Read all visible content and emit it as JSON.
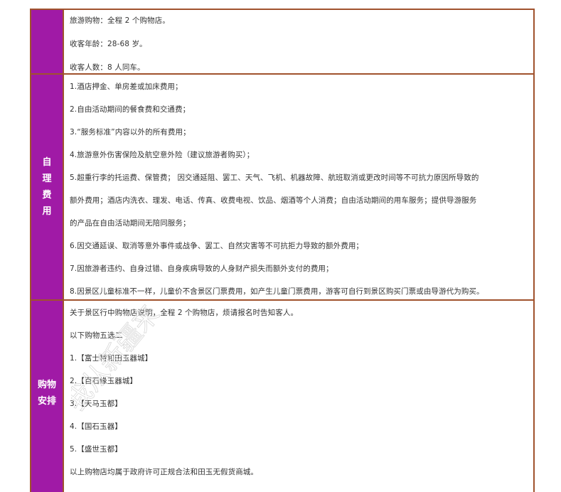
{
  "rows": [
    {
      "label": "",
      "lines": [
        "旅游购物：全程 2 个购物店。",
        "收客年龄：28-68 岁。",
        "收客人数：8 人同车。"
      ]
    },
    {
      "label_lines": [
        "自",
        "理",
        "费",
        "用"
      ],
      "lines": [
        "1.酒店押金、单房差或加床费用；",
        "2.自由活动期间的餐食费和交通费；",
        "3.“服务标准”内容以外的所有费用；",
        "4.旅游意外伤害保险及航空意外险（建议旅游者购买）；",
        "5.超重行李的托运费、保管费；  因交通延阻、罢工、天气、飞机、机器故障、航班取消或更改时间等不可抗力原因所导致的",
        "额外费用；酒店内洗衣、理发、电话、传真、收费电视、饮品、烟酒等个人消费；自由活动期间的用车服务；提供导游服务",
        "的产品在自由活动期间无陪同服务；",
        "6.因交通延误、取消等意外事件或战争、罢工、自然灾害等不可抗拒力导致的额外费用；",
        "7.因旅游者违约、自身过错、自身疾病导致的人身财产损失而额外支付的费用；",
        "8.因景区儿童标准不一样，儿童价不含景区门票费用，如产生儿童门票费用，游客可自行到景区购买门票或由导游代为购买。"
      ]
    },
    {
      "label_lines": [
        "购物",
        "安排"
      ],
      "lines": [
        "关于景区行中购物店说明，全程 2 个购物店，烦请报名时告知客人。",
        "以下购物五选二",
        "1.【富士特和田玉器城】",
        "2.【百石缘玉器城】",
        "3.【天马玉都】",
        "4.【国石玉器】",
        "5.【盛世玉都】",
        "以上购物店均属于政府许可正规合法和田玉无假货商城。"
      ]
    }
  ],
  "watermark": "我从新疆来",
  "colors": {
    "label_bg": "#a01aa6",
    "border": "#a0522d"
  }
}
